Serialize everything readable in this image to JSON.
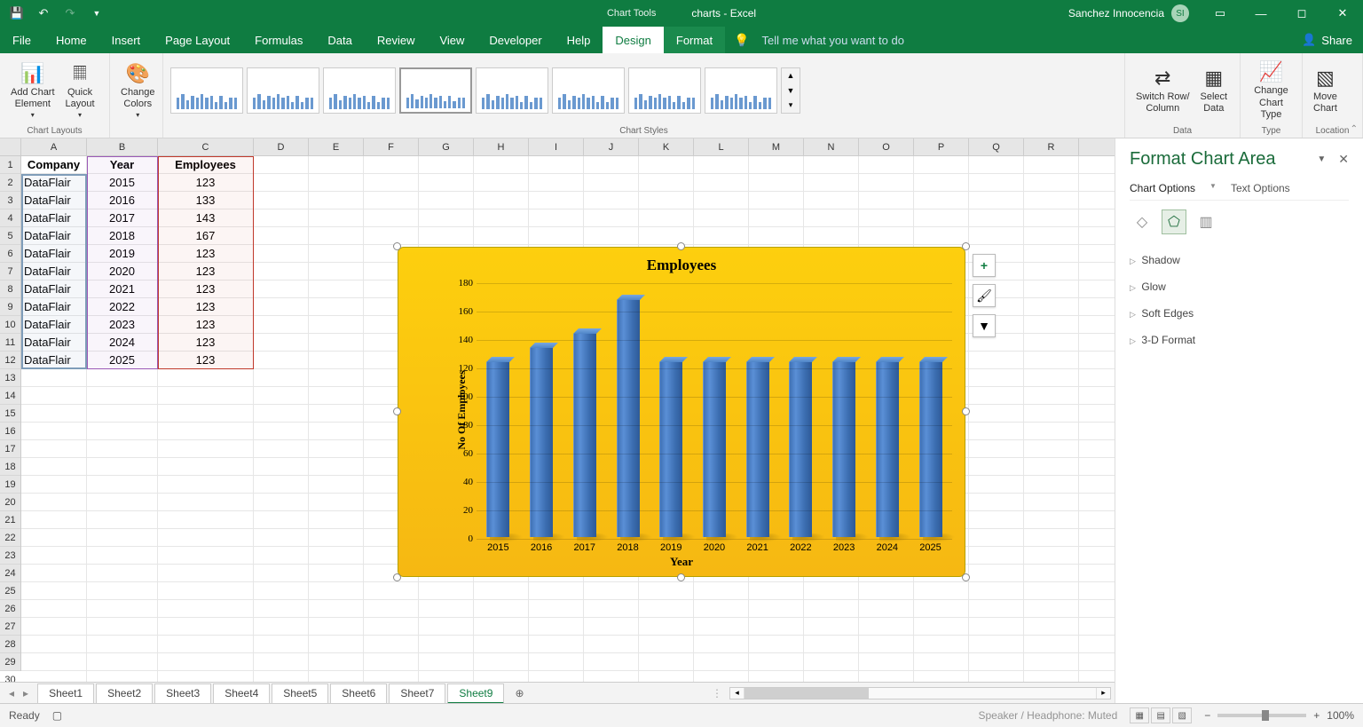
{
  "title_context": "Chart Tools",
  "title_doc": "charts  -  Excel",
  "user_name": "Sanchez Innocencia",
  "user_initials": "SI",
  "menu": [
    "File",
    "Home",
    "Insert",
    "Page Layout",
    "Formulas",
    "Data",
    "Review",
    "View",
    "Developer",
    "Help",
    "Design",
    "Format"
  ],
  "tellme": "Tell me what you want to do",
  "share": "Share",
  "ribbon": {
    "chart_layouts": {
      "label": "Chart Layouts",
      "add": "Add Chart\nElement",
      "quick": "Quick\nLayout"
    },
    "colors": {
      "btn": "Change\nColors"
    },
    "styles": {
      "label": "Chart Styles"
    },
    "data": {
      "label": "Data",
      "switch": "Switch Row/\nColumn",
      "select": "Select\nData"
    },
    "type": {
      "label": "Type",
      "change": "Change\nChart Type"
    },
    "location": {
      "label": "Location",
      "move": "Move\nChart"
    }
  },
  "cols": [
    "A",
    "B",
    "C",
    "D",
    "E",
    "F",
    "G",
    "H",
    "I",
    "J",
    "K",
    "L",
    "M",
    "N",
    "O",
    "P",
    "Q",
    "R"
  ],
  "headers": {
    "company": "Company",
    "year": "Year",
    "employees": "Employees"
  },
  "rows": [
    {
      "c": "DataFlair",
      "y": "2015",
      "e": "123"
    },
    {
      "c": "DataFlair",
      "y": "2016",
      "e": "133"
    },
    {
      "c": "DataFlair",
      "y": "2017",
      "e": "143"
    },
    {
      "c": "DataFlair",
      "y": "2018",
      "e": "167"
    },
    {
      "c": "DataFlair",
      "y": "2019",
      "e": "123"
    },
    {
      "c": "DataFlair",
      "y": "2020",
      "e": "123"
    },
    {
      "c": "DataFlair",
      "y": "2021",
      "e": "123"
    },
    {
      "c": "DataFlair",
      "y": "2022",
      "e": "123"
    },
    {
      "c": "DataFlair",
      "y": "2023",
      "e": "123"
    },
    {
      "c": "DataFlair",
      "y": "2024",
      "e": "123"
    },
    {
      "c": "DataFlair",
      "y": "2025",
      "e": "123"
    }
  ],
  "sheets": [
    "Sheet1",
    "Sheet2",
    "Sheet3",
    "Sheet4",
    "Sheet5",
    "Sheet6",
    "Sheet7",
    "Sheet9"
  ],
  "active_sheet": "Sheet9",
  "format_pane": {
    "title": "Format Chart Area",
    "tab1": "Chart Options",
    "tab2": "Text Options",
    "sections": [
      "Shadow",
      "Glow",
      "Soft Edges",
      "3-D Format"
    ]
  },
  "status_ready": "Ready",
  "status_speaker": "Speaker / Headphone: Muted",
  "zoom": "100%",
  "chart_data": {
    "type": "bar",
    "title": "Employees",
    "xlabel": "Year",
    "ylabel": "No Of Employees",
    "ylim": [
      0,
      180
    ],
    "yticks": [
      0,
      20,
      40,
      60,
      80,
      100,
      120,
      140,
      160,
      180
    ],
    "categories": [
      "2015",
      "2016",
      "2017",
      "2018",
      "2019",
      "2020",
      "2021",
      "2022",
      "2023",
      "2024",
      "2025"
    ],
    "values": [
      123,
      133,
      143,
      167,
      123,
      123,
      123,
      123,
      123,
      123,
      123
    ]
  }
}
